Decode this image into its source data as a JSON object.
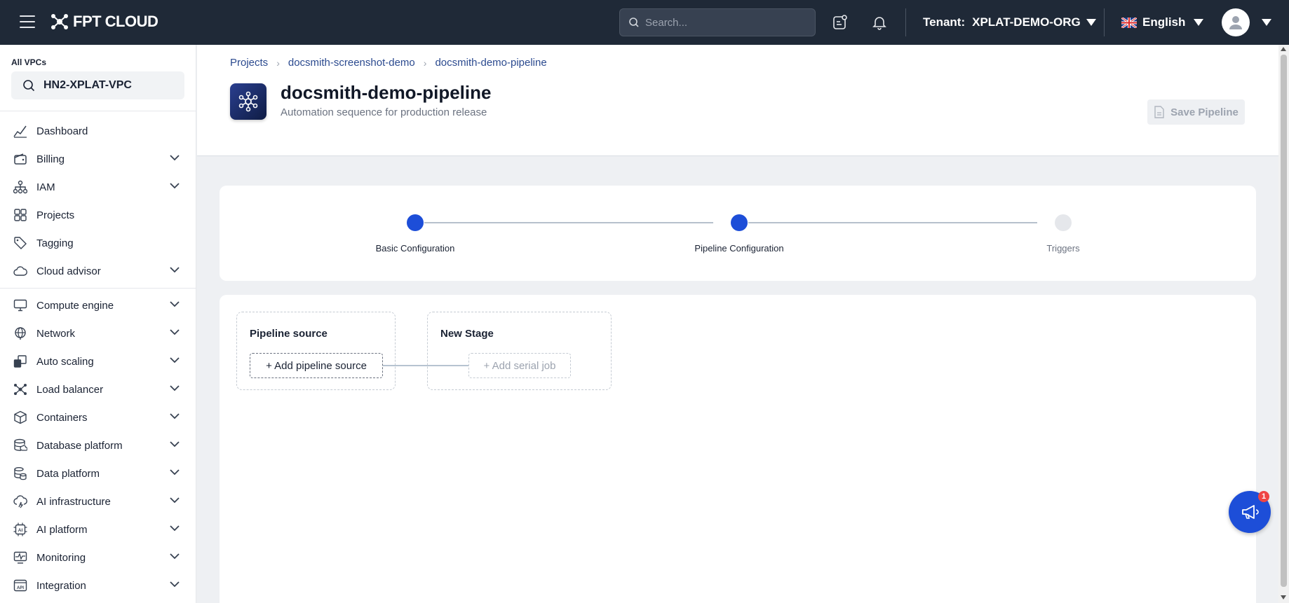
{
  "topbar": {
    "logo_text": "FPT CLOUD",
    "search_placeholder": "Search...",
    "tenant_label": "Tenant:",
    "tenant_value": "XPLAT-DEMO-ORG",
    "language": "English"
  },
  "sidebar": {
    "vpc_label": "All VPCs",
    "vpc_value": "HN2-XPLAT-VPC",
    "items": [
      {
        "label": "Dashboard",
        "icon": "chart-line-icon",
        "expandable": false
      },
      {
        "label": "Billing",
        "icon": "wallet-icon",
        "expandable": true
      },
      {
        "label": "IAM",
        "icon": "hierarchy-icon",
        "expandable": true
      },
      {
        "label": "Projects",
        "icon": "grid-icon",
        "expandable": false
      },
      {
        "label": "Tagging",
        "icon": "tag-icon",
        "expandable": false
      },
      {
        "label": "Cloud advisor",
        "icon": "cloud-icon",
        "expandable": true
      },
      {
        "label": "Compute engine",
        "icon": "monitor-icon",
        "expandable": true
      },
      {
        "label": "Network",
        "icon": "globe-icon",
        "expandable": true
      },
      {
        "label": "Auto scaling",
        "icon": "scaling-icon",
        "expandable": true
      },
      {
        "label": "Load balancer",
        "icon": "nodes-icon",
        "expandable": true
      },
      {
        "label": "Containers",
        "icon": "cube-icon",
        "expandable": true
      },
      {
        "label": "Database platform",
        "icon": "database-icon",
        "expandable": true
      },
      {
        "label": "Data platform",
        "icon": "data-stack-icon",
        "expandable": true
      },
      {
        "label": "AI infrastructure",
        "icon": "cloud-ai-icon",
        "expandable": true
      },
      {
        "label": "AI platform",
        "icon": "ai-chip-icon",
        "expandable": true
      },
      {
        "label": "Monitoring",
        "icon": "pulse-icon",
        "expandable": true
      },
      {
        "label": "Integration",
        "icon": "api-icon",
        "expandable": true
      }
    ]
  },
  "breadcrumb": [
    "Projects",
    "docsmith-screenshot-demo",
    "docsmith-demo-pipeline"
  ],
  "page": {
    "title": "docsmith-demo-pipeline",
    "subtitle": "Automation sequence for production release",
    "save_label": "Save Pipeline"
  },
  "stepper": [
    {
      "label": "Basic Configuration",
      "status": "done"
    },
    {
      "label": "Pipeline Configuration",
      "status": "done"
    },
    {
      "label": "Triggers",
      "status": "todo"
    }
  ],
  "pipeline": {
    "source_title": "Pipeline source",
    "add_source_label": "+ Add pipeline source",
    "stage_title": "New Stage",
    "add_job_label": "+ Add serial job"
  },
  "fab": {
    "badge": "1"
  },
  "colors": {
    "topbar": "#1f2937",
    "accent": "#1d4ed8",
    "step_todo": "#e5e7eb"
  }
}
